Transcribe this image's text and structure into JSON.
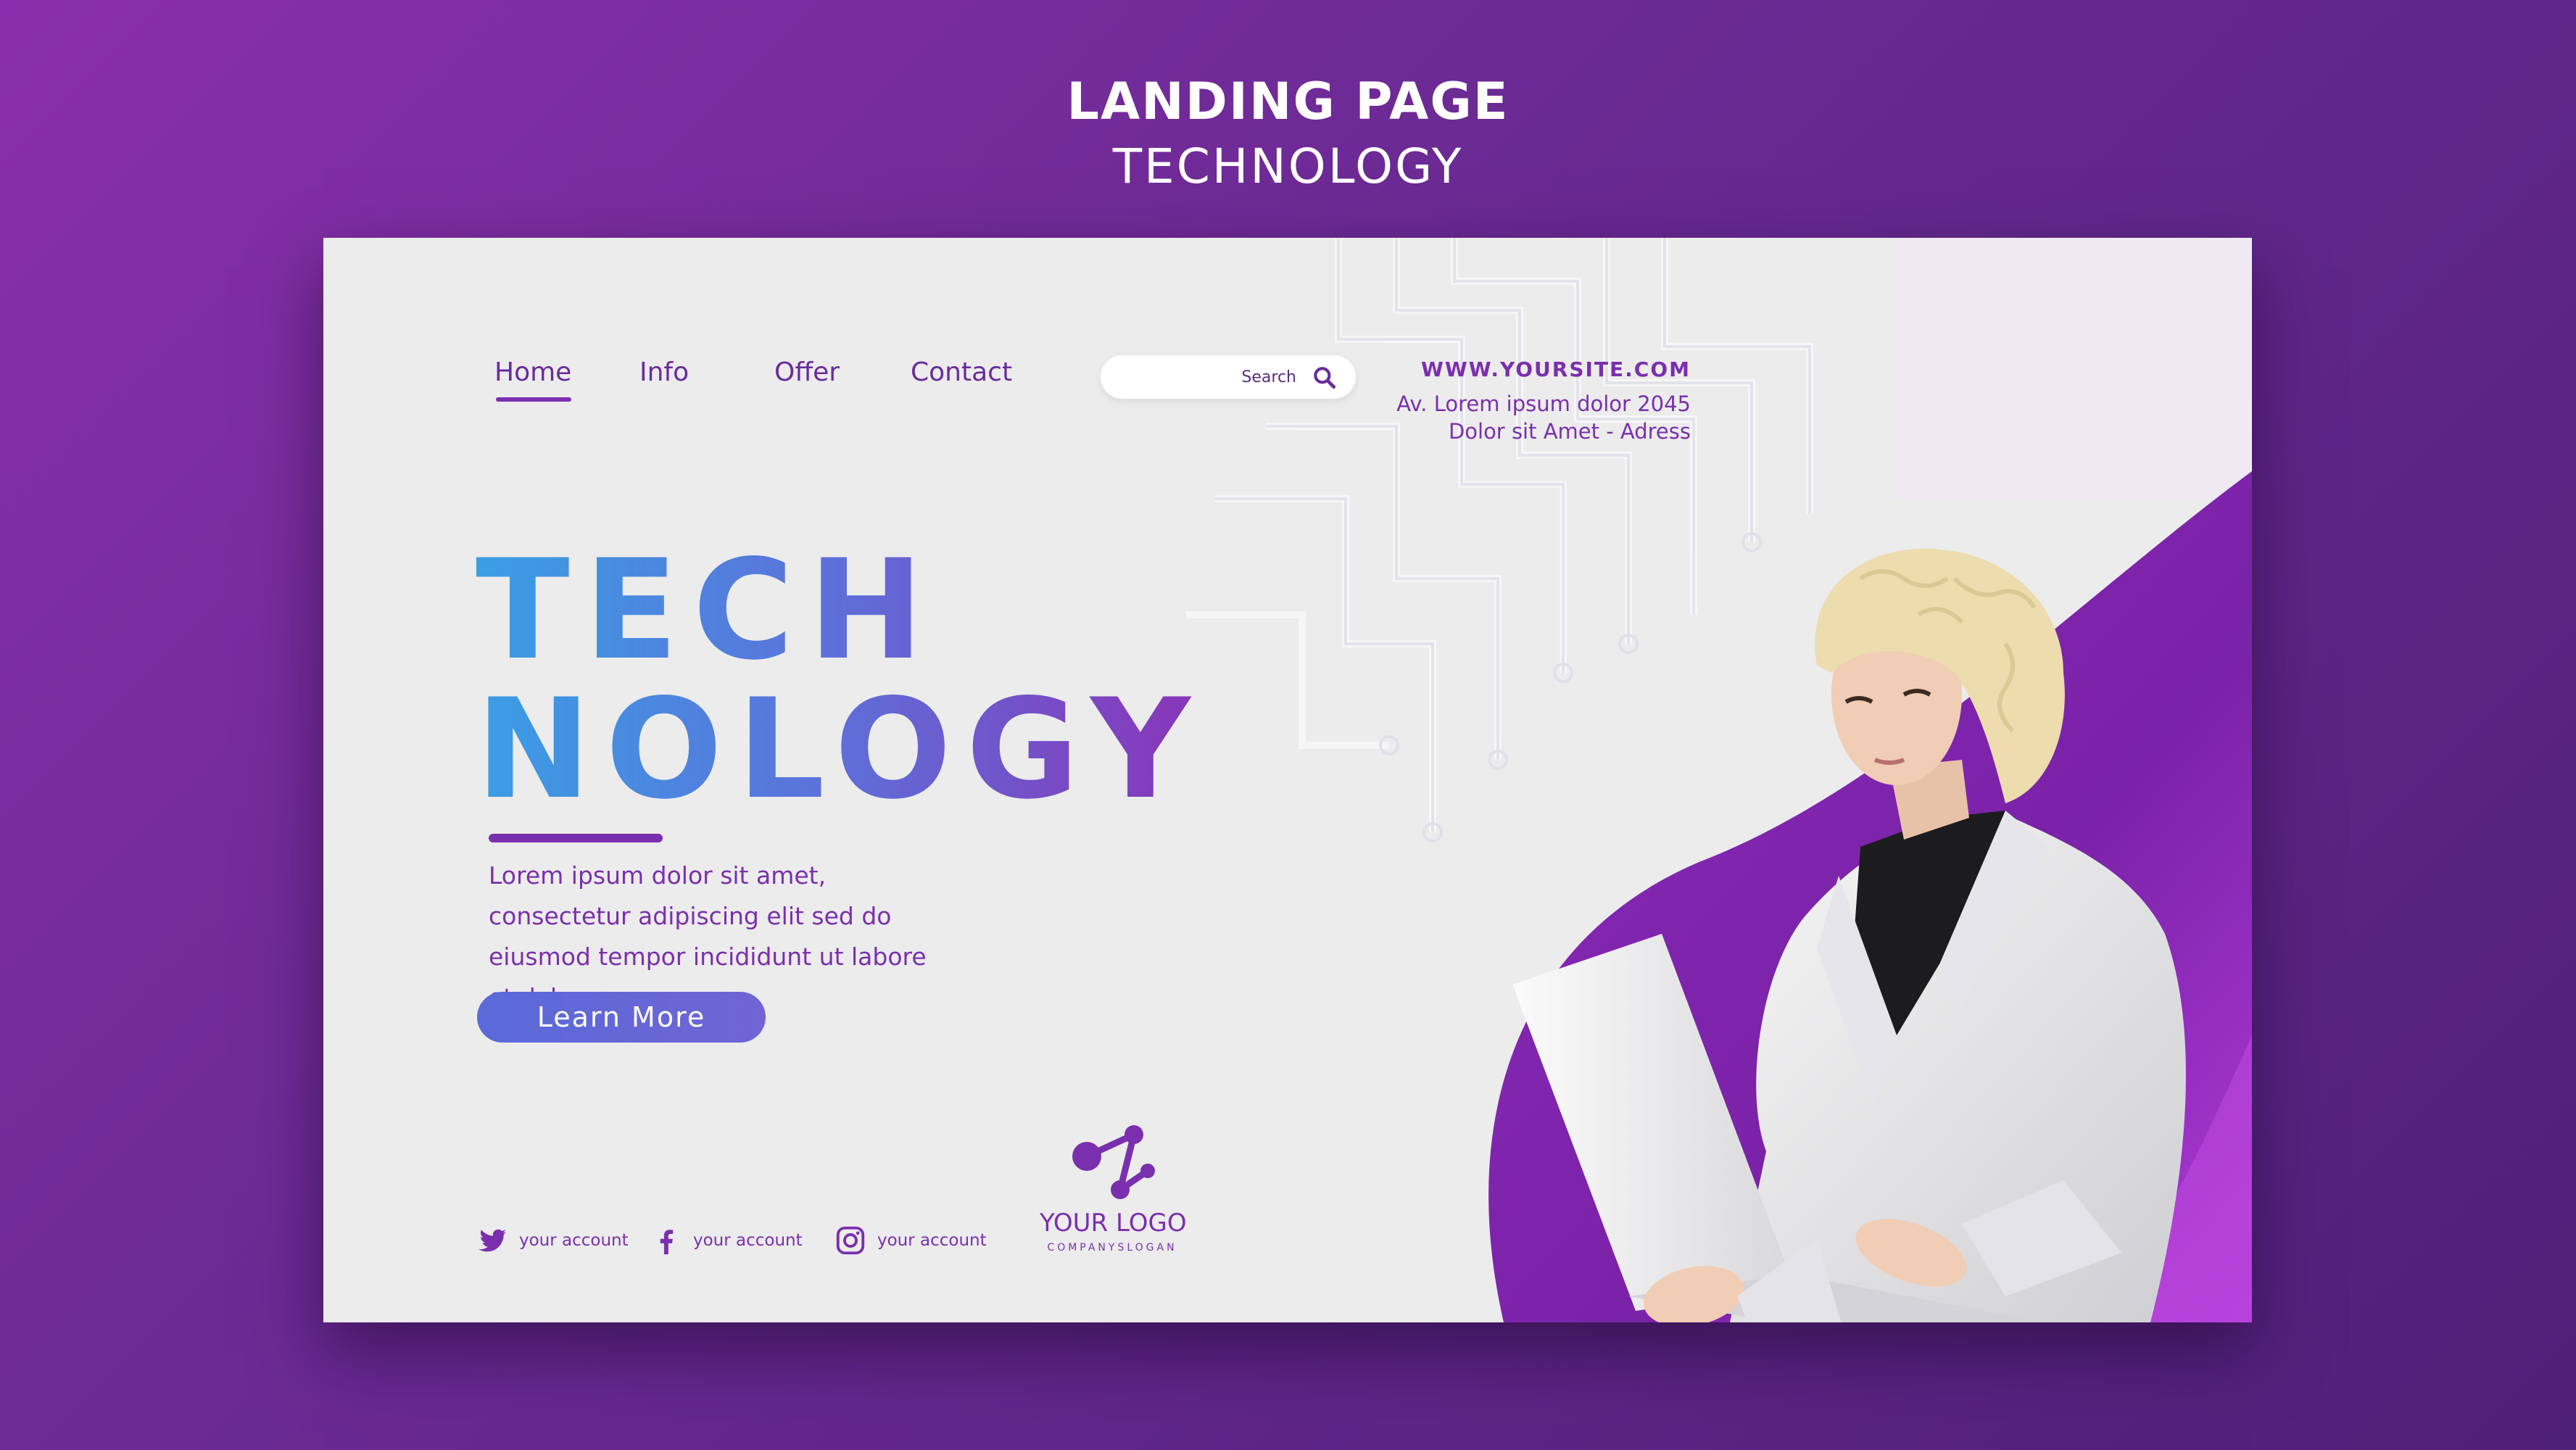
{
  "header": {
    "title": "LANDING PAGE",
    "subtitle": "TECHNOLOGY"
  },
  "nav": {
    "items": [
      {
        "label": "Home",
        "active": true
      },
      {
        "label": "Info",
        "active": false
      },
      {
        "label": "Offer",
        "active": false
      },
      {
        "label": "Contact",
        "active": false
      }
    ]
  },
  "search": {
    "placeholder": "Search",
    "value": "",
    "icon": "search-icon"
  },
  "contact": {
    "website": "WWW.YOURSITE.COM",
    "address_line1": "Av. Lorem ipsum dolor 2045",
    "address_line2": "Dolor sit Amet - Adress"
  },
  "hero": {
    "title_line1": "TECH",
    "title_line2": "NOLOGY",
    "text": "Lorem ipsum dolor sit amet, consectetur adipiscing elit sed do eiusmod tempor incididunt ut labore et dolore.",
    "button_label": "Learn More",
    "image": "woman-with-laptop"
  },
  "social": [
    {
      "icon": "twitter-icon",
      "label": "your account"
    },
    {
      "icon": "facebook-icon",
      "label": "your account"
    },
    {
      "icon": "instagram-icon",
      "label": "your account"
    }
  ],
  "logo": {
    "name": "YOUR LOGO",
    "slogan": "COMPANYSLOGAN",
    "icon": "network-nodes-icon"
  },
  "colors": {
    "background": "#7b2a9e",
    "card": "#ececec",
    "accent": "#7a2fae",
    "gradient_start": "#3a9ee4",
    "gradient_end": "#8a34b8",
    "button": "#6168d8"
  }
}
